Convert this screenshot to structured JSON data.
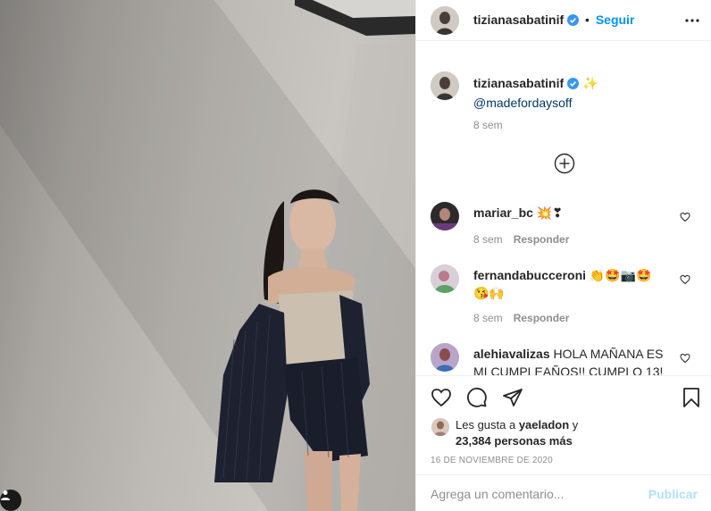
{
  "header": {
    "username": "tizianasabatinif",
    "separator": "•",
    "follow_label": "Seguir",
    "verified_icon": "verified-badge-icon",
    "more_icon": "more-options-icon"
  },
  "caption": {
    "username": "tizianasabatinif",
    "emoji": "✨",
    "mention": "@madefordaysoff",
    "time": "8 sem"
  },
  "load_more_icon": "plus-circle-icon",
  "comments": [
    {
      "username": "mariar_bc",
      "text": "💥❣",
      "time": "8 sem",
      "reply": "Responder"
    },
    {
      "username": "fernandabucceroni",
      "text": "👏🤩📷🤩 😘🙌",
      "time": "8 sem",
      "reply": "Responder"
    },
    {
      "username": "alehiavalizas",
      "text": "HOLA MAÑANA ES MI CUMPLEAÑOS!! CUMPLO 13!",
      "time": "",
      "reply": ""
    }
  ],
  "likes": {
    "prefix": "Les gusta a ",
    "first_user": "yaeladon",
    "joiner": " y",
    "count": "23,384 personas más"
  },
  "date": "16 DE NOVIEMBRE DE 2020",
  "add_comment": {
    "placeholder": "Agrega un comentario...",
    "post_label": "Publicar"
  },
  "colors": {
    "accent": "#0095f6",
    "mention": "#00376b",
    "muted": "#8e8e8e",
    "post_disabled": "#b2dffc",
    "border": "#efefef"
  }
}
